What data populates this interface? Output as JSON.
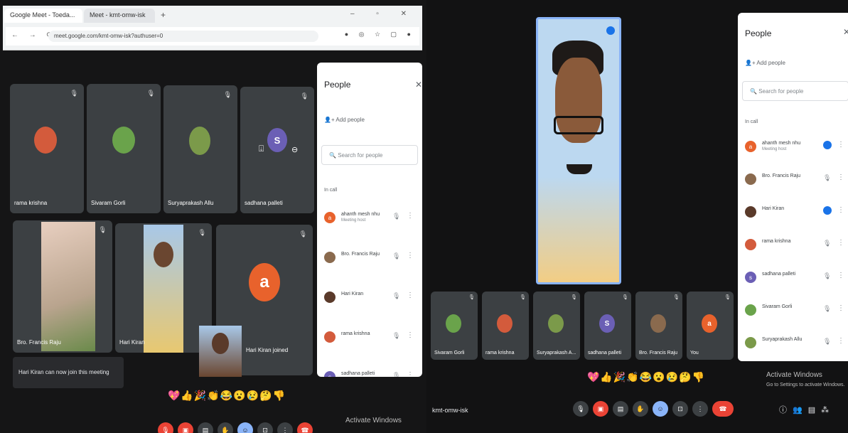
{
  "browser": {
    "tabs": [
      "Google Meet - Toeda...",
      "Meet - kmt-omw-isk"
    ],
    "url": "meet.google.com/kmt-omw-isk?authuser=0"
  },
  "left_meeting": {
    "tiles": [
      {
        "name": "rama krishna",
        "avatar_color": "#d35b3c"
      },
      {
        "name": "Sivaram Gorli",
        "avatar_color": "#6aa34b"
      },
      {
        "name": "Suryaprakash Allu",
        "avatar_color": "#7b9a4a"
      },
      {
        "name": "sadhana palleti",
        "avatar_letter": "S",
        "avatar_color": "#6b5fb5"
      },
      {
        "name": "Bro. Francis Raju"
      },
      {
        "name": "Hari Kiran"
      },
      {
        "avatar_letter": "a",
        "avatar_color": "#e8622c"
      }
    ],
    "joined_notice": "Hari Kiran joined",
    "toast": "Hari Kiran can now join this meeting",
    "reactions": "💖👍🎉👏😂😮😢🤔👎",
    "watermark": "Activate Windows"
  },
  "people_left": {
    "title": "People",
    "add": "Add people",
    "search_placeholder": "Search for people",
    "section": "In call",
    "rows": [
      {
        "initial": "a",
        "color": "#e8622c",
        "name": "ahanth mesh nhu",
        "sub": "Meeting host"
      },
      {
        "initial": "",
        "color": "#8a6a4e",
        "name": "Bro. Francis Raju"
      },
      {
        "initial": "",
        "color": "#5a3a2a",
        "name": "Hari Kiran"
      },
      {
        "initial": "",
        "color": "#d35b3c",
        "name": "rama krishna"
      },
      {
        "initial": "s",
        "color": "#6b5fb5",
        "name": "sadhana palleti"
      }
    ]
  },
  "right_meeting": {
    "strip": [
      {
        "name": "Sivaram Gorli",
        "color": "#6aa34b"
      },
      {
        "name": "rama krishna",
        "color": "#d35b3c"
      },
      {
        "name": "Suryaprakash A...",
        "color": "#7b9a4a"
      },
      {
        "name": "sadhana palleti",
        "letter": "S",
        "color": "#6b5fb5"
      },
      {
        "name": "Bro. Francis Raju",
        "color": "#8a6a4e"
      },
      {
        "name": "You",
        "letter": "a",
        "color": "#e8622c"
      }
    ],
    "meeting_code": "kmt-omw-isk",
    "reactions": "💖👍🎉👏😂😮😢🤔👎",
    "watermark": "Activate Windows",
    "watermark_sub": "Go to Settings to activate Windows."
  },
  "people_right": {
    "title": "People",
    "add": "Add people",
    "search_placeholder": "Search for people",
    "section": "In call",
    "rows": [
      {
        "initial": "a",
        "color": "#e8622c",
        "name": "ahanth mesh nhu",
        "sub": "Meeting host"
      },
      {
        "initial": "",
        "color": "#8a6a4e",
        "name": "Bro. Francis Raju"
      },
      {
        "initial": "",
        "color": "#5a3a2a",
        "name": "Hari Kiran"
      },
      {
        "initial": "",
        "color": "#d35b3c",
        "name": "rama krishna"
      },
      {
        "initial": "s",
        "color": "#6b5fb5",
        "name": "sadhana palleti"
      },
      {
        "initial": "",
        "color": "#6aa34b",
        "name": "Sivaram Gorli"
      },
      {
        "initial": "",
        "color": "#7b9a4a",
        "name": "Suryaprakash Allu"
      }
    ]
  }
}
